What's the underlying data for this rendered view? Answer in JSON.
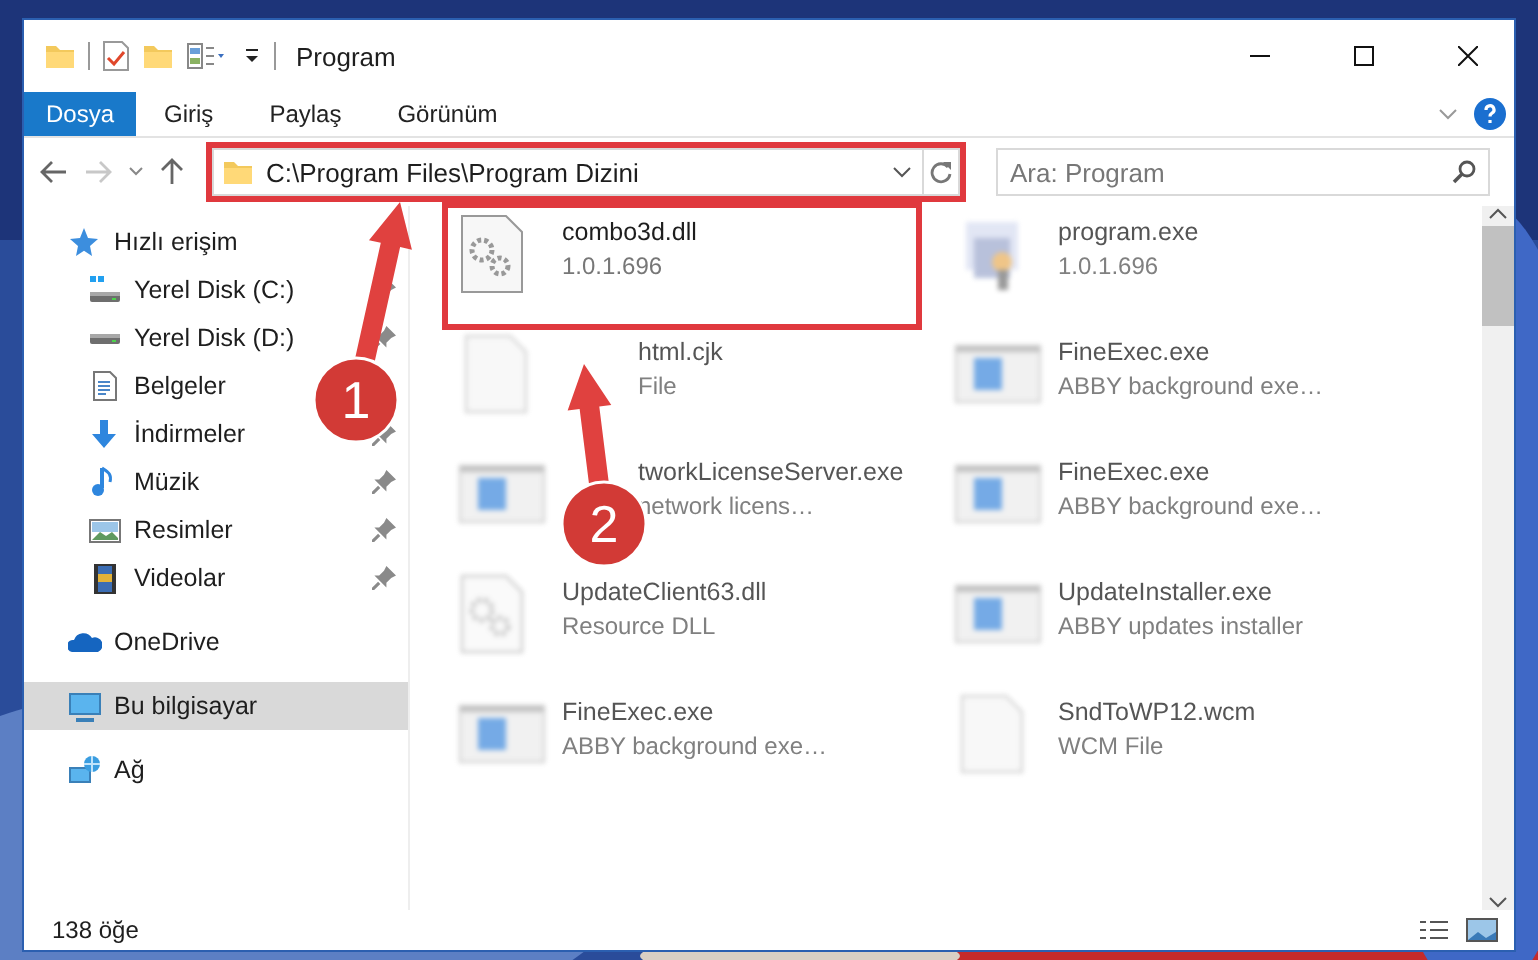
{
  "window": {
    "title": "Program"
  },
  "ribbon": {
    "tabs": [
      {
        "label": "Dosya",
        "selected": true
      },
      {
        "label": "Giriş",
        "selected": false
      },
      {
        "label": "Paylaş",
        "selected": false
      },
      {
        "label": "Görünüm",
        "selected": false
      }
    ]
  },
  "address": {
    "path": "C:\\Program Files\\Program Dizini",
    "highlighted": true
  },
  "search": {
    "placeholder": "Ara: Program"
  },
  "nav": [
    {
      "label": "Hızlı erişim",
      "kind": "star",
      "selected": false,
      "children": [
        {
          "label": "Yerel Disk (C:)",
          "kind": "disk-c",
          "pinned": true
        },
        {
          "label": "Yerel Disk (D:)",
          "kind": "disk",
          "pinned": true
        },
        {
          "label": "Belgeler",
          "kind": "docs"
        },
        {
          "label": "İndirmeler",
          "kind": "download",
          "pinned": true
        },
        {
          "label": "Müzik",
          "kind": "music",
          "pinned": true
        },
        {
          "label": "Resimler",
          "kind": "pictures",
          "pinned": true
        },
        {
          "label": "Videolar",
          "kind": "video",
          "pinned": true
        }
      ]
    },
    {
      "label": "OneDrive",
      "kind": "cloud",
      "selected": false
    },
    {
      "label": "Bu bilgisayar",
      "kind": "computer",
      "selected": true
    },
    {
      "label": "Ağ",
      "kind": "network",
      "selected": false
    }
  ],
  "files": [
    {
      "name": "combo3d.dll",
      "detail": "1.0.1.696",
      "kind": "dll",
      "blurred": false,
      "highlighted": true,
      "covered": false
    },
    {
      "name": "program.exe",
      "detail": "1.0.1.696",
      "kind": "setup",
      "blurred": true,
      "highlighted": false,
      "covered": false
    },
    {
      "name": "html.cjk",
      "detail": "File",
      "kind": "blank",
      "blurred": true,
      "highlighted": false,
      "covered": true
    },
    {
      "name": "FineExec.exe",
      "detail": "ABBY background exe…",
      "kind": "app",
      "blurred": true,
      "highlighted": false,
      "covered": false
    },
    {
      "name": "tworkLicenseServer.exe",
      "detail": "network licens…",
      "kind": "app",
      "blurred": true,
      "highlighted": false,
      "covered": true
    },
    {
      "name": "FineExec.exe",
      "detail": "ABBY background exe…",
      "kind": "app",
      "blurred": true,
      "highlighted": false,
      "covered": false
    },
    {
      "name": "UpdateClient63.dll",
      "detail": "Resource DLL",
      "kind": "dll",
      "blurred": true,
      "highlighted": false,
      "covered": false
    },
    {
      "name": "UpdateInstaller.exe",
      "detail": "ABBY updates installer",
      "kind": "app",
      "blurred": true,
      "highlighted": false,
      "covered": false
    },
    {
      "name": "FineExec.exe",
      "detail": "ABBY background exe…",
      "kind": "app",
      "blurred": true,
      "highlighted": false,
      "covered": false
    },
    {
      "name": "SndToWP12.wcm",
      "detail": "WCM File",
      "kind": "blank",
      "blurred": true,
      "highlighted": false,
      "covered": false
    }
  ],
  "annotations": [
    {
      "label": "1"
    },
    {
      "label": "2"
    }
  ],
  "status_bar": {
    "count": "138 öğe"
  }
}
